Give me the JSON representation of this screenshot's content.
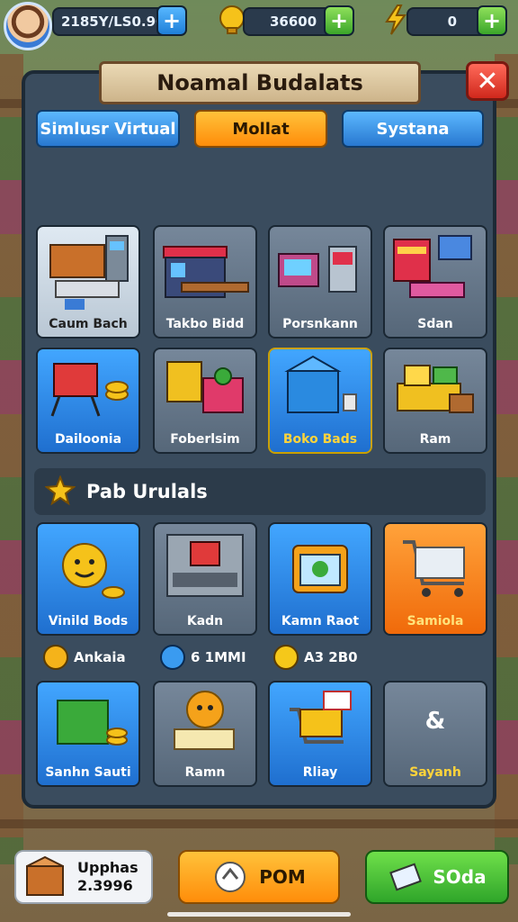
{
  "topbar": {
    "currency1": "2185Y/LS0.90",
    "currency2": "36600",
    "currency3": "0",
    "plus": "+"
  },
  "panel": {
    "title": "Noamal Budalats",
    "close": "✕"
  },
  "tabs": [
    {
      "label": "Simlusr Virtual"
    },
    {
      "label": "Mollat"
    },
    {
      "label": "Systana"
    }
  ],
  "grid1": [
    {
      "label": "Caum Bach"
    },
    {
      "label": "Takbo Bidd"
    },
    {
      "label": "Porsnkann"
    },
    {
      "label": "Sdan"
    },
    {
      "label": "Dailoonia"
    },
    {
      "label": "Foberlsim"
    },
    {
      "label": "Boko Bads"
    },
    {
      "label": "Ram"
    }
  ],
  "section": {
    "title": "Pab Urulals"
  },
  "grid2": [
    {
      "label": "Vinild Bods"
    },
    {
      "label": "Kadn"
    },
    {
      "label": "Kamn Raot"
    },
    {
      "label": "Samiola"
    },
    {
      "label": "Sanhn Sauti"
    },
    {
      "label": "Ramn"
    },
    {
      "label": "Rliay"
    },
    {
      "label": "Sayanh"
    }
  ],
  "grid2_center_symbol": "&",
  "stats": [
    {
      "label": "Ankaia",
      "color": "#f5b31a"
    },
    {
      "label": "6 1MMI",
      "color": "#3a9bf0"
    },
    {
      "label": "A3 2B0",
      "color": "#f5c81a"
    }
  ],
  "bottom": {
    "left_title": "Upphas",
    "left_value": "2.3996",
    "center": "POM",
    "right": "SOda"
  }
}
